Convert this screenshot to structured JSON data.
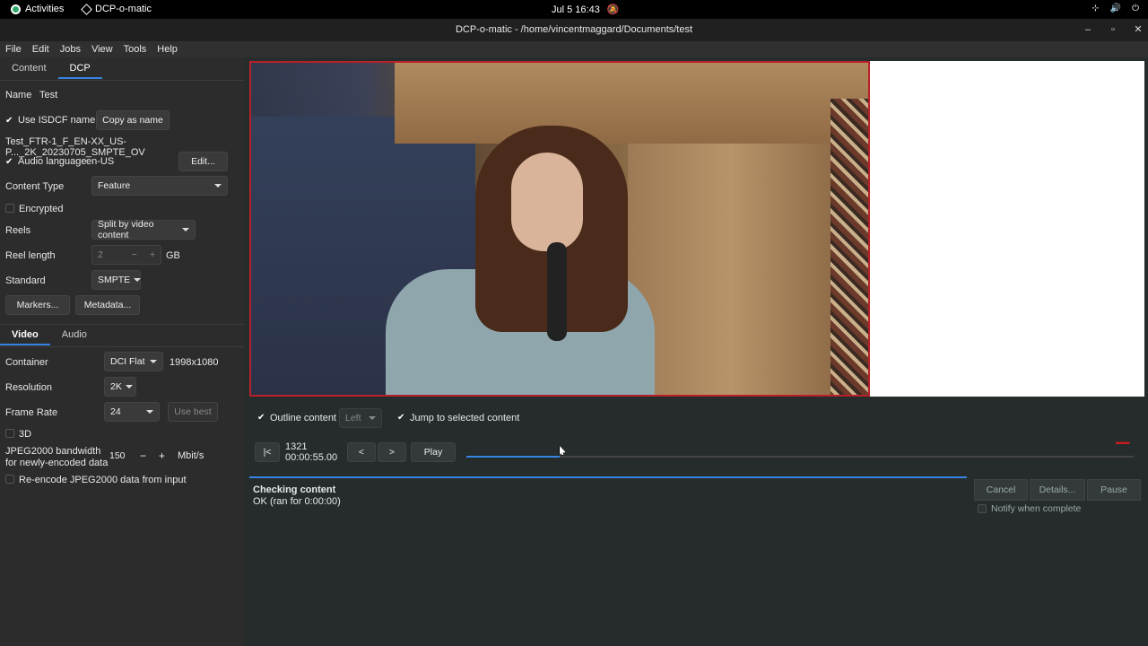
{
  "topbar": {
    "activities": "Activities",
    "app_name": "DCP-o-matic",
    "clock": "Jul 5  16:43",
    "icons": [
      "network-icon",
      "volume-icon",
      "power-icon"
    ]
  },
  "window": {
    "title": "DCP-o-matic - /home/vincentmaggard/Documents/test",
    "controls": [
      "–",
      "▫",
      "✕"
    ]
  },
  "menu": [
    "File",
    "Edit",
    "Jobs",
    "View",
    "Tools",
    "Help"
  ],
  "left": {
    "top_tabs": [
      "Content",
      "DCP"
    ],
    "active_top_tab": "DCP",
    "name_label": "Name",
    "name_value": "Test",
    "use_isdcf_label": "Use ISDCF name",
    "copy_as_name": "Copy as name",
    "dcp_name": "Test_FTR-1_F_EN-XX_US-P..._2K_20230705_SMPTE_OV",
    "audio_language_label": "Audio language",
    "audio_language_value": "en-US",
    "edit_button": "Edit...",
    "content_type_label": "Content Type",
    "content_type_value": "Feature",
    "encrypted_label": "Encrypted",
    "reels_label": "Reels",
    "reels_value": "Split by video content",
    "reel_length_label": "Reel length",
    "reel_length_value": "2",
    "reel_length_minus": "−",
    "reel_length_plus": "+",
    "reel_length_unit": "GB",
    "standard_label": "Standard",
    "standard_value": "SMPTE",
    "markers_button": "Markers...",
    "metadata_button": "Metadata...",
    "sub_tabs": [
      "Video",
      "Audio"
    ],
    "active_sub_tab": "Video",
    "container_label": "Container",
    "container_value": "DCI Flat",
    "container_size": "1998x1080",
    "resolution_label": "Resolution",
    "resolution_value": "2K",
    "frame_rate_label": "Frame Rate",
    "frame_rate_value": "24",
    "use_best_button": "Use best",
    "three_d_label": "3D",
    "jpeg_label_line1": "JPEG2000 bandwidth",
    "jpeg_label_line2": "for newly-encoded data",
    "jpeg_value": "150",
    "jpeg_minus": "−",
    "jpeg_plus": "+",
    "jpeg_unit": "Mbit/s",
    "reencode_label": "Re-encode JPEG2000 data from input"
  },
  "viewer": {
    "outline_content_label": "Outline content",
    "eye_value": "Left",
    "jump_label": "Jump to selected content",
    "to_start_button": "|<",
    "frame": "1321",
    "timecode": "00:00:55.00",
    "prev_button": "<",
    "next_button": ">",
    "play_button": "Play",
    "position_fraction": 0.14
  },
  "jobs": {
    "progress_fraction": 1.0,
    "title": "Checking content",
    "status": "OK (ran for 0:00:00)",
    "cancel": "Cancel",
    "details": "Details...",
    "pause": "Pause",
    "notify": "Notify when complete"
  },
  "colors": {
    "accent": "#3584e4",
    "outline_red": "#b8202a"
  }
}
